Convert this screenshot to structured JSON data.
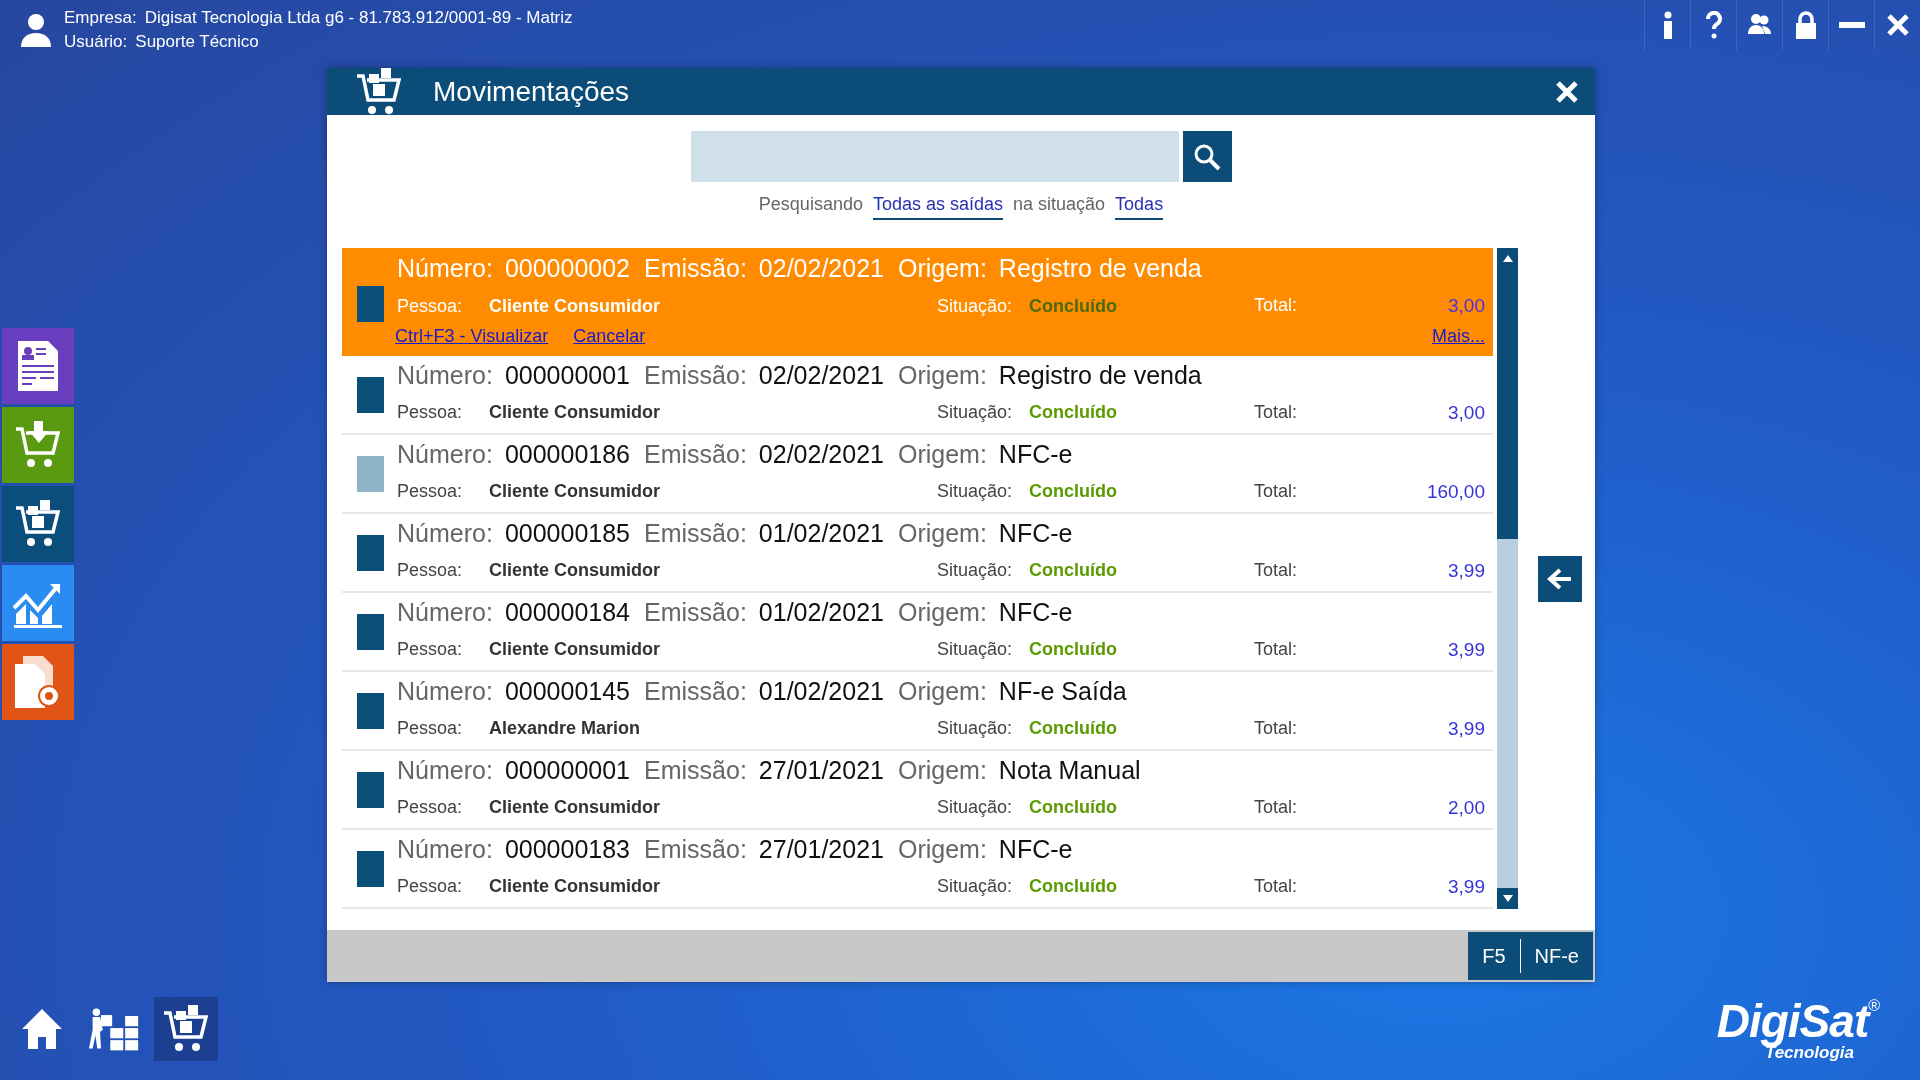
{
  "header": {
    "company_label": "Empresa:",
    "company": "Digisat Tecnologia Ltda g6 - 81.783.912/0001-89 - Matriz",
    "user_label": "Usuário:",
    "user": "Suporte Técnico"
  },
  "dialog": {
    "title": "Movimentações",
    "filter": {
      "prefix": "Pesquisando",
      "scope": "Todas as saídas",
      "middle": "na situação",
      "status": "Todas"
    },
    "rows": [
      {
        "selected": true,
        "color": "#0b5078",
        "number_label": "Número:",
        "number": "000000002",
        "date_label": "Emissão:",
        "date": "02/02/2021",
        "origin_label": "Origem:",
        "origin": "Registro de venda",
        "person_label": "Pessoa:",
        "person": "Cliente Consumidor",
        "status_label": "Situação:",
        "status": "Concluído",
        "total_label": "Total:",
        "total": "3,00",
        "actions": [
          "Ctrl+F3 - Visualizar",
          "Cancelar"
        ],
        "more": "Mais..."
      },
      {
        "selected": false,
        "color": "#0b5078",
        "number_label": "Número:",
        "number": "000000001",
        "date_label": "Emissão:",
        "date": "02/02/2021",
        "origin_label": "Origem:",
        "origin": "Registro de venda",
        "person_label": "Pessoa:",
        "person": "Cliente Consumidor",
        "status_label": "Situação:",
        "status": "Concluído",
        "total_label": "Total:",
        "total": "3,00"
      },
      {
        "selected": false,
        "color": "#8fb3c9",
        "number_label": "Número:",
        "number": "000000186",
        "date_label": "Emissão:",
        "date": "02/02/2021",
        "origin_label": "Origem:",
        "origin": "NFC-e",
        "person_label": "Pessoa:",
        "person": "Cliente Consumidor",
        "status_label": "Situação:",
        "status": "Concluído",
        "total_label": "Total:",
        "total": "160,00"
      },
      {
        "selected": false,
        "color": "#0b5078",
        "number_label": "Número:",
        "number": "000000185",
        "date_label": "Emissão:",
        "date": "01/02/2021",
        "origin_label": "Origem:",
        "origin": "NFC-e",
        "person_label": "Pessoa:",
        "person": "Cliente Consumidor",
        "status_label": "Situação:",
        "status": "Concluído",
        "total_label": "Total:",
        "total": "3,99"
      },
      {
        "selected": false,
        "color": "#0b5078",
        "number_label": "Número:",
        "number": "000000184",
        "date_label": "Emissão:",
        "date": "01/02/2021",
        "origin_label": "Origem:",
        "origin": "NFC-e",
        "person_label": "Pessoa:",
        "person": "Cliente Consumidor",
        "status_label": "Situação:",
        "status": "Concluído",
        "total_label": "Total:",
        "total": "3,99"
      },
      {
        "selected": false,
        "color": "#0b5078",
        "number_label": "Número:",
        "number": "000000145",
        "date_label": "Emissão:",
        "date": "01/02/2021",
        "origin_label": "Origem:",
        "origin": "NF-e Saída",
        "person_label": "Pessoa:",
        "person": "Alexandre Marion",
        "status_label": "Situação:",
        "status": "Concluído",
        "total_label": "Total:",
        "total": "3,99"
      },
      {
        "selected": false,
        "color": "#0b5078",
        "number_label": "Número:",
        "number": "000000001",
        "date_label": "Emissão:",
        "date": "27/01/2021",
        "origin_label": "Origem:",
        "origin": "Nota Manual",
        "person_label": "Pessoa:",
        "person": "Cliente Consumidor",
        "status_label": "Situação:",
        "status": "Concluído",
        "total_label": "Total:",
        "total": "2,00"
      },
      {
        "selected": false,
        "color": "#0b5078",
        "number_label": "Número:",
        "number": "000000183",
        "date_label": "Emissão:",
        "date": "27/01/2021",
        "origin_label": "Origem:",
        "origin": "NFC-e",
        "person_label": "Pessoa:",
        "person": "Cliente Consumidor",
        "status_label": "Situação:",
        "status": "Concluído",
        "total_label": "Total:",
        "total": "3,99"
      }
    ],
    "footer_buttons": [
      "F5",
      "NF-e"
    ]
  },
  "logo": {
    "name": "DigiSat",
    "mark": "®",
    "tagline": "Tecnologia"
  }
}
